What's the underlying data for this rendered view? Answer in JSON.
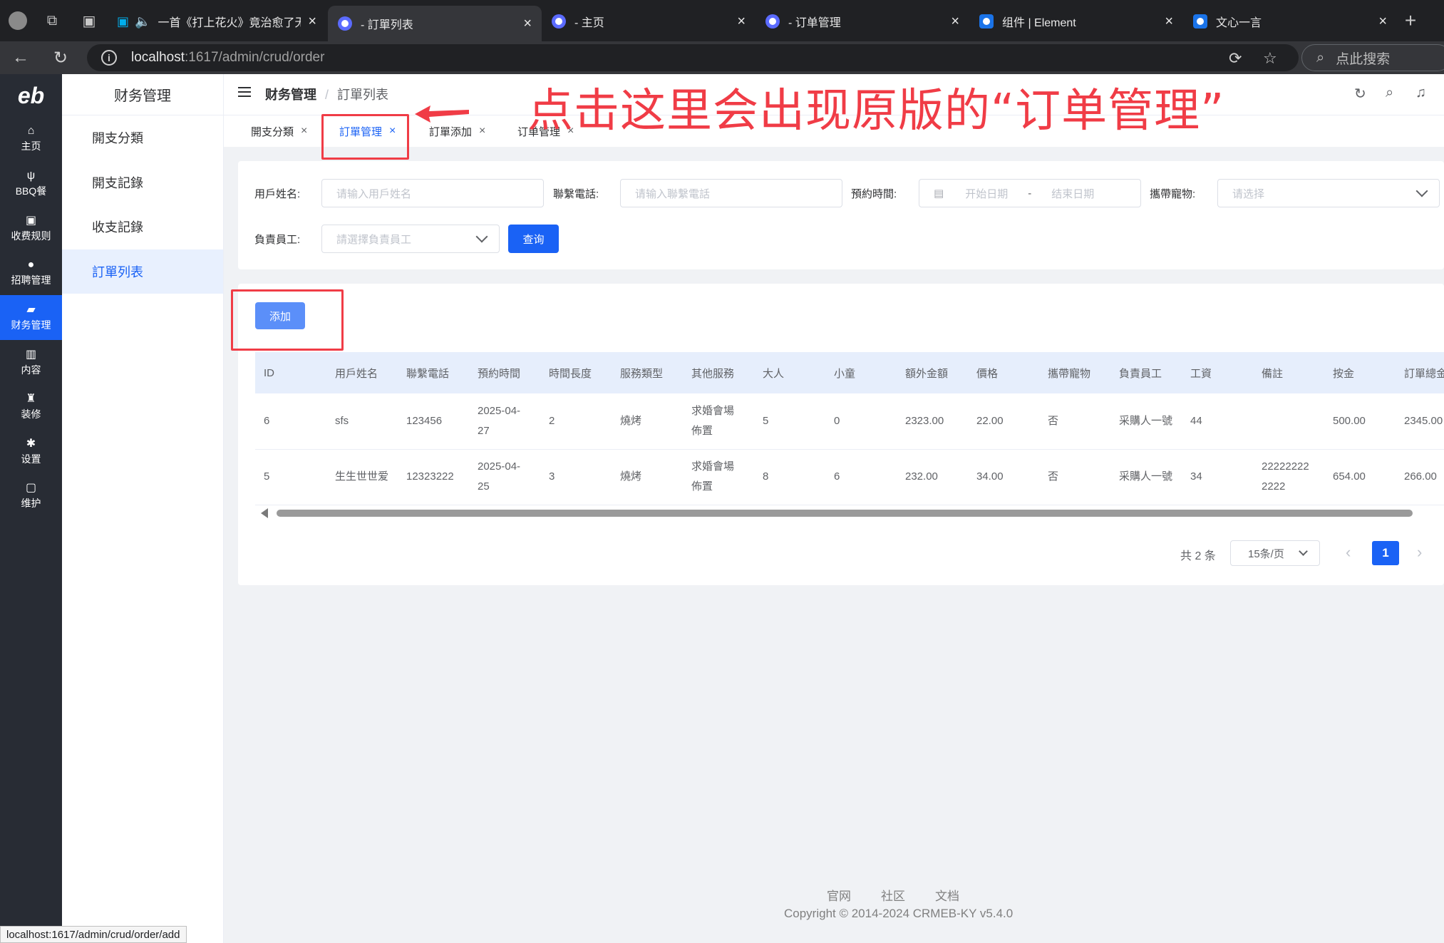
{
  "browser": {
    "tabs": [
      {
        "title": "一首《打上花火》竟治愈了无",
        "active": false
      },
      {
        "title": "- 訂單列表",
        "active": true
      },
      {
        "title": "- 主页",
        "active": false
      },
      {
        "title": "- 订单管理",
        "active": false
      },
      {
        "title": "组件 | Element",
        "active": false
      },
      {
        "title": "文心一言",
        "active": false
      }
    ],
    "url_host": "localhost",
    "url_path": ":1617/admin/crud/order",
    "search_placeholder": "点此搜索",
    "status_url": "localhost:1617/admin/crud/order/add"
  },
  "app": {
    "logo": "eb",
    "main_nav": [
      {
        "label": "主页",
        "icon": "home-icon",
        "glyph": "⌂"
      },
      {
        "label": "BBQ餐",
        "icon": "utensils-icon",
        "glyph": "ψ"
      },
      {
        "label": "收费规则",
        "icon": "receipt-icon",
        "glyph": "▣"
      },
      {
        "label": "招聘管理",
        "icon": "user-icon",
        "glyph": "●"
      },
      {
        "label": "财务管理",
        "icon": "wallet-icon",
        "glyph": "▰"
      },
      {
        "label": "内容",
        "icon": "content-icon",
        "glyph": "▥"
      },
      {
        "label": "装修",
        "icon": "brush-icon",
        "glyph": "♜"
      },
      {
        "label": "设置",
        "icon": "gear-icon",
        "glyph": "✱"
      },
      {
        "label": "维护",
        "icon": "chip-icon",
        "glyph": "▢"
      }
    ],
    "sub_nav_title": "财务管理",
    "sub_nav": [
      "開支分類",
      "開支記錄",
      "收支記錄",
      "訂單列表"
    ],
    "breadcrumb": {
      "parent": "财务管理",
      "sep": "/",
      "current": "訂單列表"
    },
    "annotation": "点击这里会出现原版的“订单管理”",
    "page_tabs": [
      {
        "label": "開支分類",
        "close": "×"
      },
      {
        "label": "訂單管理",
        "close": "×"
      },
      {
        "label": "訂單添加",
        "close": "×"
      },
      {
        "label": "订单管理",
        "close": "×"
      }
    ]
  },
  "filters": {
    "username_label": "用戶姓名:",
    "username_placeholder": "请输入用戶姓名",
    "phone_label": "聯繫電話:",
    "phone_placeholder": "请输入聯繫電話",
    "time_label": "預約時間:",
    "start_placeholder": "开始日期",
    "range_sep": "-",
    "end_placeholder": "结束日期",
    "pet_label": "攜帶寵物:",
    "pet_placeholder": "请选择",
    "staff_label": "負責員工:",
    "staff_placeholder": "請選擇負責員工",
    "query_button": "查询"
  },
  "add_button": "添加",
  "table": {
    "columns": [
      "ID",
      "用戶姓名",
      "聯繫電話",
      "預約時間",
      "時間長度",
      "服務類型",
      "其他服務",
      "大人",
      "小童",
      "額外金額",
      "價格",
      "攜帶寵物",
      "負責員工",
      "工資",
      "備註",
      "按金",
      "訂單總金"
    ],
    "rows": [
      [
        "6",
        "sfs",
        "123456",
        "2025-04-27",
        "2",
        "燒烤",
        "求婚會場佈置",
        "5",
        "0",
        "2323.00",
        "22.00",
        "否",
        "采購人一號",
        "44",
        "",
        "500.00",
        "2345.00"
      ],
      [
        "5",
        "生生世世爱",
        "12323222",
        "2025-04-25",
        "3",
        "燒烤",
        "求婚會場佈置",
        "8",
        "6",
        "232.00",
        "34.00",
        "否",
        "采購人一號",
        "34",
        "222222222222",
        "654.00",
        "266.00"
      ]
    ]
  },
  "pagination": {
    "total": "共 2 条",
    "page_size": "15条/页",
    "current": "1",
    "prev": "‹",
    "next": "›"
  },
  "footer": {
    "links": [
      "官网",
      "社区",
      "文档"
    ],
    "copyright": "Copyright © 2014-2024 CRMEB-KY v5.4.0"
  }
}
